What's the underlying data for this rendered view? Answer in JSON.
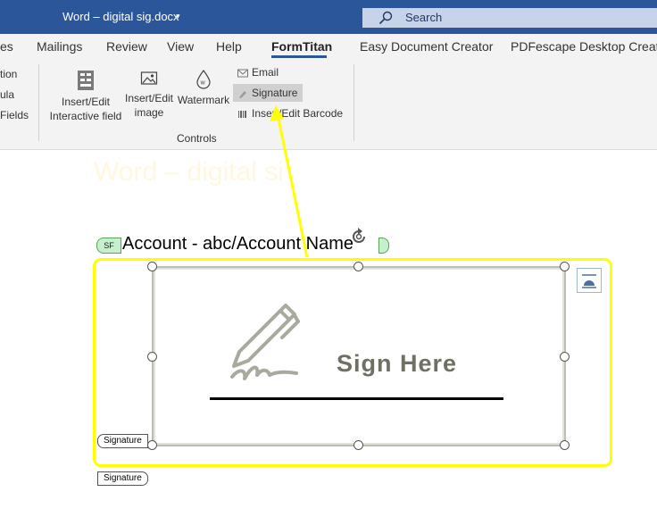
{
  "titlebar": {
    "doc_title": "Word – digital sig.docx",
    "search_label": "Search"
  },
  "tabs": [
    {
      "label": "es"
    },
    {
      "label": "Mailings"
    },
    {
      "label": "Review"
    },
    {
      "label": "View"
    },
    {
      "label": "Help"
    },
    {
      "label": "FormTitan"
    },
    {
      "label": "Easy Document Creator"
    },
    {
      "label": "PDFescape Desktop Creator"
    }
  ],
  "ribbon": {
    "left_items": [
      "tion",
      "ula",
      "Fields"
    ],
    "buttons": {
      "interactive_field": "Insert/Edit\nInteractive field",
      "image": "Insert/Edit\nimage",
      "watermark": "Watermark"
    },
    "small": {
      "email": "Email",
      "signature": "Signature",
      "barcode": "Insert/Edit Barcode"
    },
    "group_label": "Controls"
  },
  "document": {
    "faded_title": "Word – digital si",
    "sf_tag": "SF",
    "account_text": "Account - abc/Account Name",
    "sign_here": "Sign Here",
    "signature_tag_1": "Signature",
    "signature_tag_2": "Signature"
  },
  "colors": {
    "title_bar": "#2b579a",
    "highlight_frame": "#ffff00",
    "arrow": "#ffff00",
    "sf_tag_bg": "#c6efce"
  },
  "icons": [
    "search-icon",
    "caret-down-icon",
    "interactive-field-icon",
    "image-icon",
    "watermark-icon",
    "email-icon",
    "signature-icon",
    "barcode-icon",
    "rotate-handle-icon",
    "pen-icon",
    "layout-options-icon"
  ]
}
